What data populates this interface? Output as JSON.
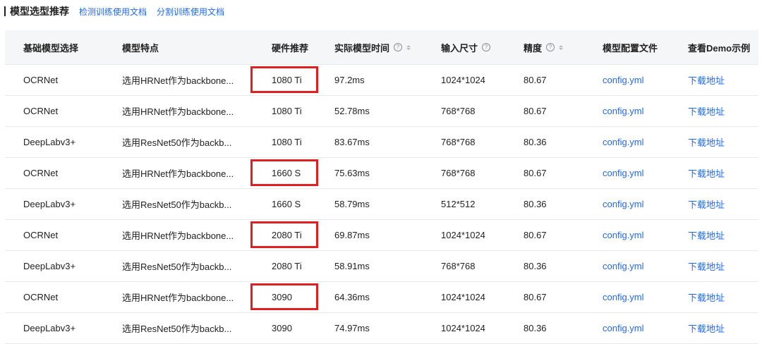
{
  "header": {
    "title": "模型选型推荐",
    "links": [
      "检测训练使用文档",
      "分割训练使用文档"
    ]
  },
  "table": {
    "columns": [
      "基础模型选择",
      "模型特点",
      "硬件推荐",
      "实际模型时间",
      "输入尺寸",
      "精度",
      "模型配置文件",
      "查看Demo示例"
    ],
    "rows": [
      {
        "model": "OCRNet",
        "feature": "选用HRNet作为backbone...",
        "hardware": "1080 Ti",
        "time": "97.2ms",
        "size": "1024*1024",
        "acc": "80.67",
        "config": "config.yml",
        "demo": "下载地址",
        "highlight": true
      },
      {
        "model": "OCRNet",
        "feature": "选用HRNet作为backbone...",
        "hardware": "1080 Ti",
        "time": "52.78ms",
        "size": "768*768",
        "acc": "80.67",
        "config": "config.yml",
        "demo": "下载地址",
        "highlight": false
      },
      {
        "model": "DeepLabv3+",
        "feature": "选用ResNet50作为backb...",
        "hardware": "1080 Ti",
        "time": "83.67ms",
        "size": "768*768",
        "acc": "80.36",
        "config": "config.yml",
        "demo": "下载地址",
        "highlight": false
      },
      {
        "model": "OCRNet",
        "feature": "选用HRNet作为backbone...",
        "hardware": "1660 S",
        "time": "75.63ms",
        "size": "768*768",
        "acc": "80.67",
        "config": "config.yml",
        "demo": "下载地址",
        "highlight": true
      },
      {
        "model": "DeepLabv3+",
        "feature": "选用ResNet50作为backb...",
        "hardware": "1660 S",
        "time": "58.79ms",
        "size": "512*512",
        "acc": "80.36",
        "config": "config.yml",
        "demo": "下载地址",
        "highlight": false
      },
      {
        "model": "OCRNet",
        "feature": "选用HRNet作为backbone...",
        "hardware": "2080 Ti",
        "time": "69.87ms",
        "size": "1024*1024",
        "acc": "80.67",
        "config": "config.yml",
        "demo": "下载地址",
        "highlight": true
      },
      {
        "model": "DeepLabv3+",
        "feature": "选用ResNet50作为backb...",
        "hardware": "2080 Ti",
        "time": "58.91ms",
        "size": "768*768",
        "acc": "80.36",
        "config": "config.yml",
        "demo": "下载地址",
        "highlight": false
      },
      {
        "model": "OCRNet",
        "feature": "选用HRNet作为backbone...",
        "hardware": "3090",
        "time": "64.36ms",
        "size": "1024*1024",
        "acc": "80.67",
        "config": "config.yml",
        "demo": "下载地址",
        "highlight": true
      },
      {
        "model": "DeepLabv3+",
        "feature": "选用ResNet50作为backb...",
        "hardware": "3090",
        "time": "74.97ms",
        "size": "1024*1024",
        "acc": "80.36",
        "config": "config.yml",
        "demo": "下载地址",
        "highlight": false
      }
    ]
  },
  "colors": {
    "link": "#2468f2",
    "highlight_border": "#e02020",
    "header_bg": "#f5f6f8"
  }
}
